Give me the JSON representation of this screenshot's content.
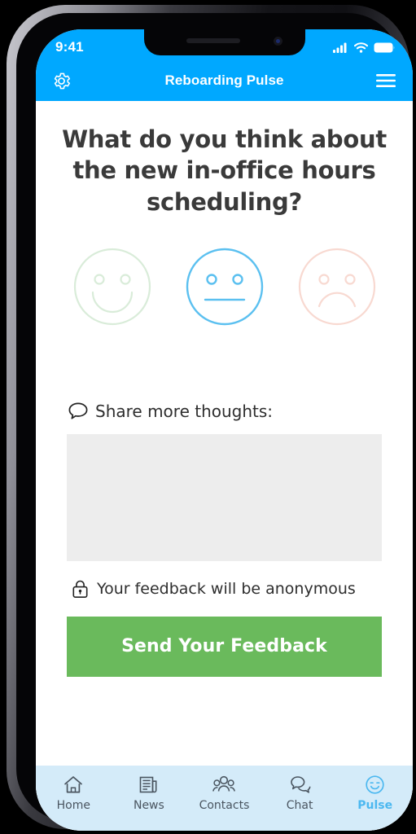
{
  "status_bar": {
    "time": "9:41",
    "signal_icon": "cellular-signal-icon",
    "wifi_icon": "wifi-icon",
    "battery_icon": "battery-full-icon"
  },
  "header": {
    "title": "Reboarding Pulse",
    "settings_icon": "gear-icon",
    "menu_icon": "hamburger-menu-icon",
    "background_color": "#00a8ff"
  },
  "main": {
    "question": "What do you think about the new in-office hours scheduling?",
    "mood_options": [
      {
        "name": "happy",
        "icon": "smiley-happy-face-icon",
        "color": "#d9ecd9",
        "selected": false
      },
      {
        "name": "neutral",
        "icon": "smiley-neutral-face-icon",
        "color": "#5bc0f0",
        "selected": true
      },
      {
        "name": "sad",
        "icon": "smiley-sad-face-icon",
        "color": "#f8d9d1",
        "selected": false
      }
    ],
    "thoughts_label": "Share more thoughts:",
    "thoughts_icon": "speech-bubble-icon",
    "thoughts_value": "",
    "thoughts_placeholder": "",
    "anonymous_notice": "Your feedback will be anonymous",
    "anonymous_icon": "lock-icon",
    "submit_label": "Send Your Feedback",
    "submit_color": "#6aba5c"
  },
  "bottom_nav": {
    "background_color": "#d4ebf9",
    "active_color": "#4cb8f0",
    "items": [
      {
        "label": "Home",
        "icon": "home-icon",
        "active": false
      },
      {
        "label": "News",
        "icon": "newspaper-icon",
        "active": false
      },
      {
        "label": "Contacts",
        "icon": "people-group-icon",
        "active": false
      },
      {
        "label": "Chat",
        "icon": "chat-bubbles-icon",
        "active": false
      },
      {
        "label": "Pulse",
        "icon": "smiley-face-icon",
        "active": true
      }
    ]
  }
}
